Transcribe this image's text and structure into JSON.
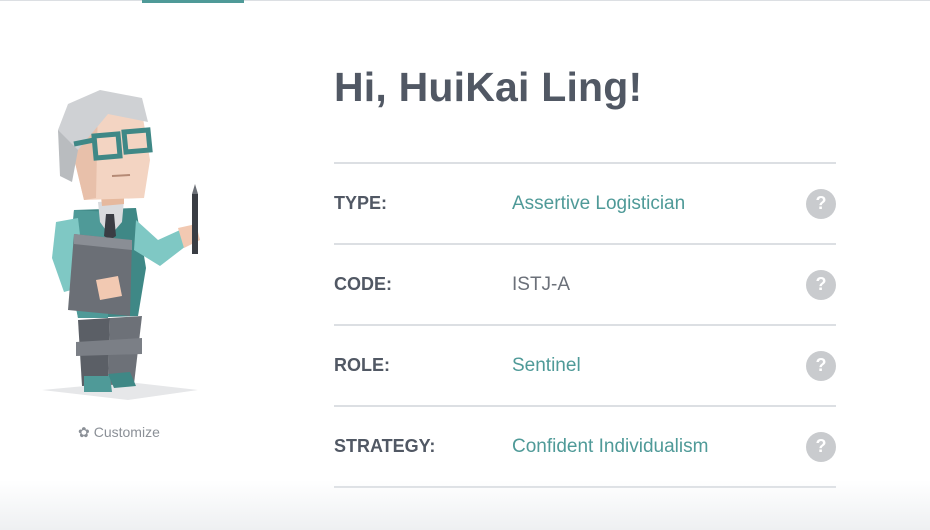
{
  "greeting": "Hi, HuiKai Ling!",
  "customize": {
    "icon": "gear-icon",
    "label": "Customize"
  },
  "profile": {
    "rows": [
      {
        "label": "TYPE:",
        "value": "Assertive Logistician"
      },
      {
        "label": "CODE:",
        "value": "ISTJ-A"
      },
      {
        "label": "ROLE:",
        "value": "Sentinel"
      },
      {
        "label": "STRATEGY:",
        "value": "Confident Individualism"
      }
    ],
    "help_icon": "?"
  },
  "colors": {
    "accent": "#4f9a98",
    "heading": "#515864",
    "muted": "#8b9097",
    "help_bg": "#c9cbce",
    "divider": "#dcdfe3"
  }
}
